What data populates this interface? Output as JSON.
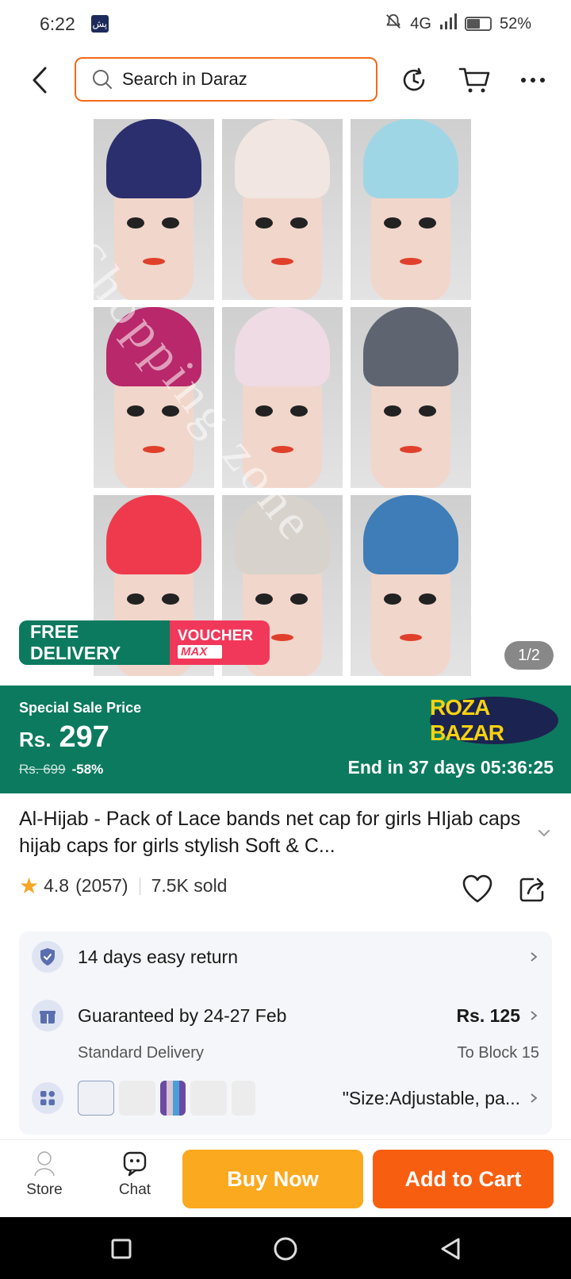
{
  "status_bar": {
    "time": "6:22",
    "app_badge": "پش",
    "network": "4G",
    "battery": "52%",
    "battery_level": 0.52
  },
  "header": {
    "search_placeholder": "Search in Daraz"
  },
  "gallery": {
    "page_indicator": "1/2",
    "watermark": "Shopping zone",
    "cap_colors": [
      "#2b2f6e",
      "#f1e6e1",
      "#9fd6e6",
      "#b8286b",
      "#efdbe4",
      "#5f6570",
      "#ef3a4d",
      "#d8d2cc",
      "#3e7db8"
    ]
  },
  "badges": {
    "free_delivery": "FREE DELIVERY",
    "voucher": "VOUCHER",
    "voucher_max": "MAX"
  },
  "sale": {
    "title": "Special Sale Price",
    "currency": "Rs.",
    "price": "297",
    "old_price": "Rs. 699",
    "discount": "-58%",
    "brand": "ROZA BAZAR",
    "countdown": "End in 37 days 05:36:25"
  },
  "product": {
    "title": "Al-Hijab - Pack of Lace bands net cap for girls HIjab caps  hijab caps for girls stylish  Soft & C...",
    "rating": "4.8",
    "reviews": "(2057)",
    "sold": "7.5K sold"
  },
  "info": {
    "return_policy": "14 days easy return",
    "delivery_guarantee": "Guaranteed by 24-27 Feb",
    "delivery_type": "Standard Delivery",
    "delivery_fee": "Rs. 125",
    "delivery_location": "To Block 15",
    "variant_text": "\"Size:Adjustable, pa..."
  },
  "bottom_bar": {
    "store_label": "Store",
    "chat_label": "Chat",
    "buy_now": "Buy Now",
    "add_to_cart": "Add to Cart"
  },
  "colors": {
    "accent_orange": "#f26a1b",
    "sale_green": "#0c7a5f",
    "buy_now": "#fba91f",
    "add_to_cart": "#f85e0f"
  }
}
